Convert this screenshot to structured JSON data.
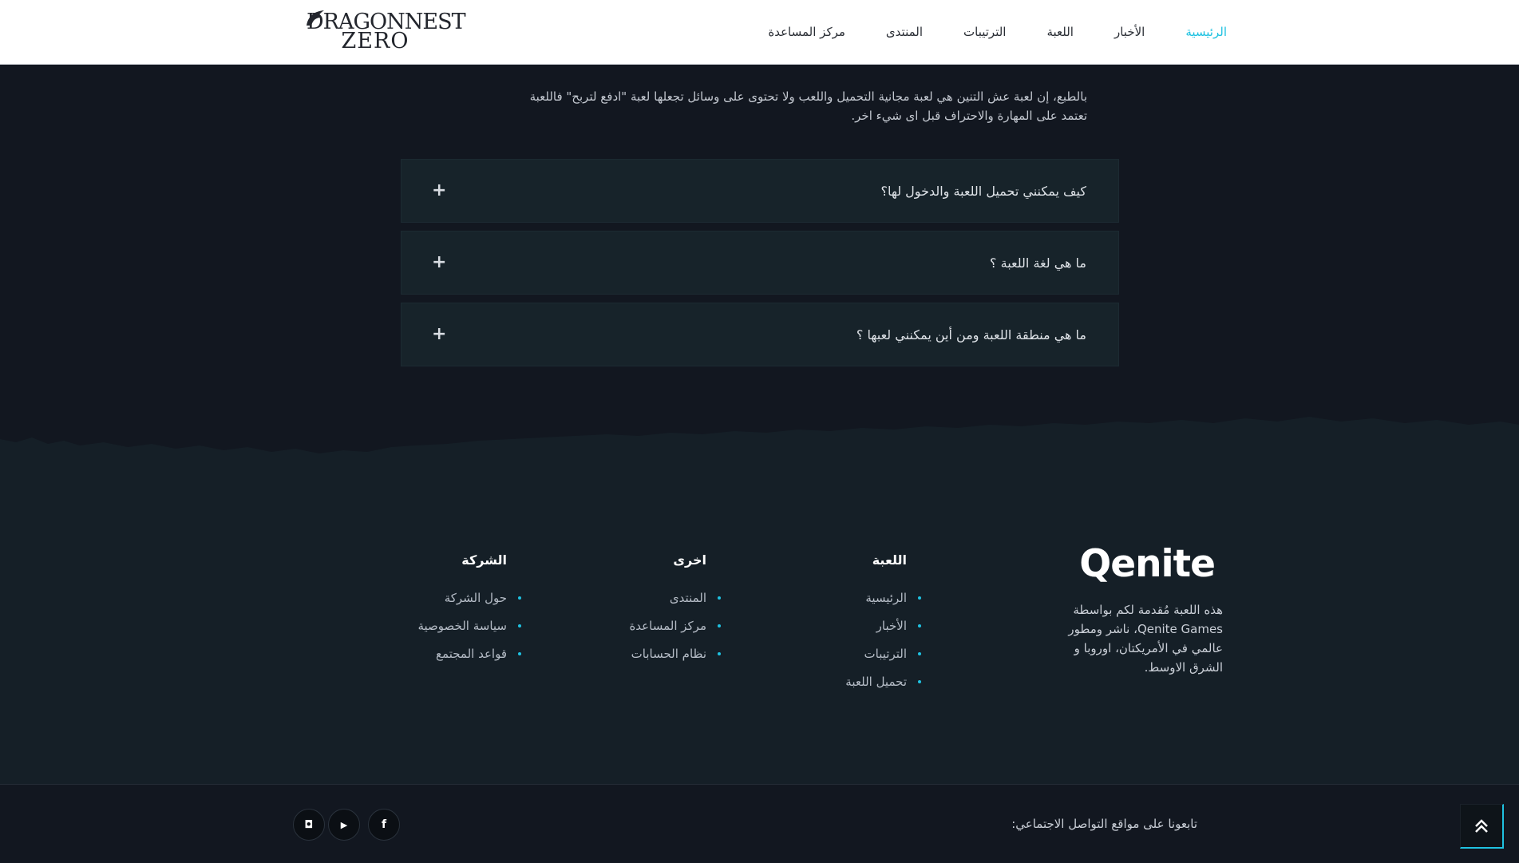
{
  "header": {
    "logo_line1": "DRAGONNEST",
    "logo_line2": "ZERO",
    "nav": [
      {
        "label": "الرئيسية",
        "active": true
      },
      {
        "label": "الأخبار",
        "active": false
      },
      {
        "label": "اللعبة",
        "active": false
      },
      {
        "label": "الترتيبات",
        "active": false
      },
      {
        "label": "المنتدى",
        "active": false
      },
      {
        "label": "مركز المساعدة",
        "active": false
      }
    ]
  },
  "faq": {
    "answer_line1": "بالطبع، إن لعبة عش التنين هي لعبة مجانية التحميل واللعب ولا تحتوى على وسائل تجعلها لعبة \"ادفع لتربح\" فاللعبة",
    "answer_line2": "تعتمد على المهارة والاحتراف قبل اى شيء اخر.",
    "items": [
      {
        "question": "كيف يمكنني تحميل اللعبة والدخول لها؟",
        "toggle": "+"
      },
      {
        "question": "ما هي لغة اللعبة ؟",
        "toggle": "+"
      },
      {
        "question": "ما هي منطقة اللعبة ومن أين يمكنني لعبها ؟",
        "toggle": "+"
      }
    ]
  },
  "footer": {
    "brand_logo": "Qenite",
    "brand_text": "هذه اللعبة مُقدمة لكم بواسطة Qenite Games، ناشر ومطور عالمي في الأمريكتان، اوروبا و الشرق الاوسط.",
    "columns": [
      {
        "title": "اللعبة",
        "links": [
          "الرئيسية",
          "الأخبار",
          "الترتيبات",
          "تحميل اللعبة"
        ]
      },
      {
        "title": "اخرى",
        "links": [
          "المنتدى",
          "مركز المساعدة",
          "نظام الحسابات"
        ]
      },
      {
        "title": "الشركة",
        "links": [
          "حول الشركة",
          "سياسة الخصوصية",
          "قواعد المجتمع"
        ]
      }
    ]
  },
  "bottom": {
    "follow_text": "تابعونا على مواقع التواصل الاجتماعي:",
    "socials": [
      {
        "name": "facebook-icon",
        "glyph": "f"
      },
      {
        "name": "youtube-icon",
        "glyph": "▶"
      },
      {
        "name": "discord-icon",
        "glyph": "◘"
      }
    ]
  },
  "colors": {
    "accent": "#1fc2e1",
    "page_bg": "#121720",
    "footer_bg": "#151f27",
    "faq_item_bg": "#17232a"
  }
}
